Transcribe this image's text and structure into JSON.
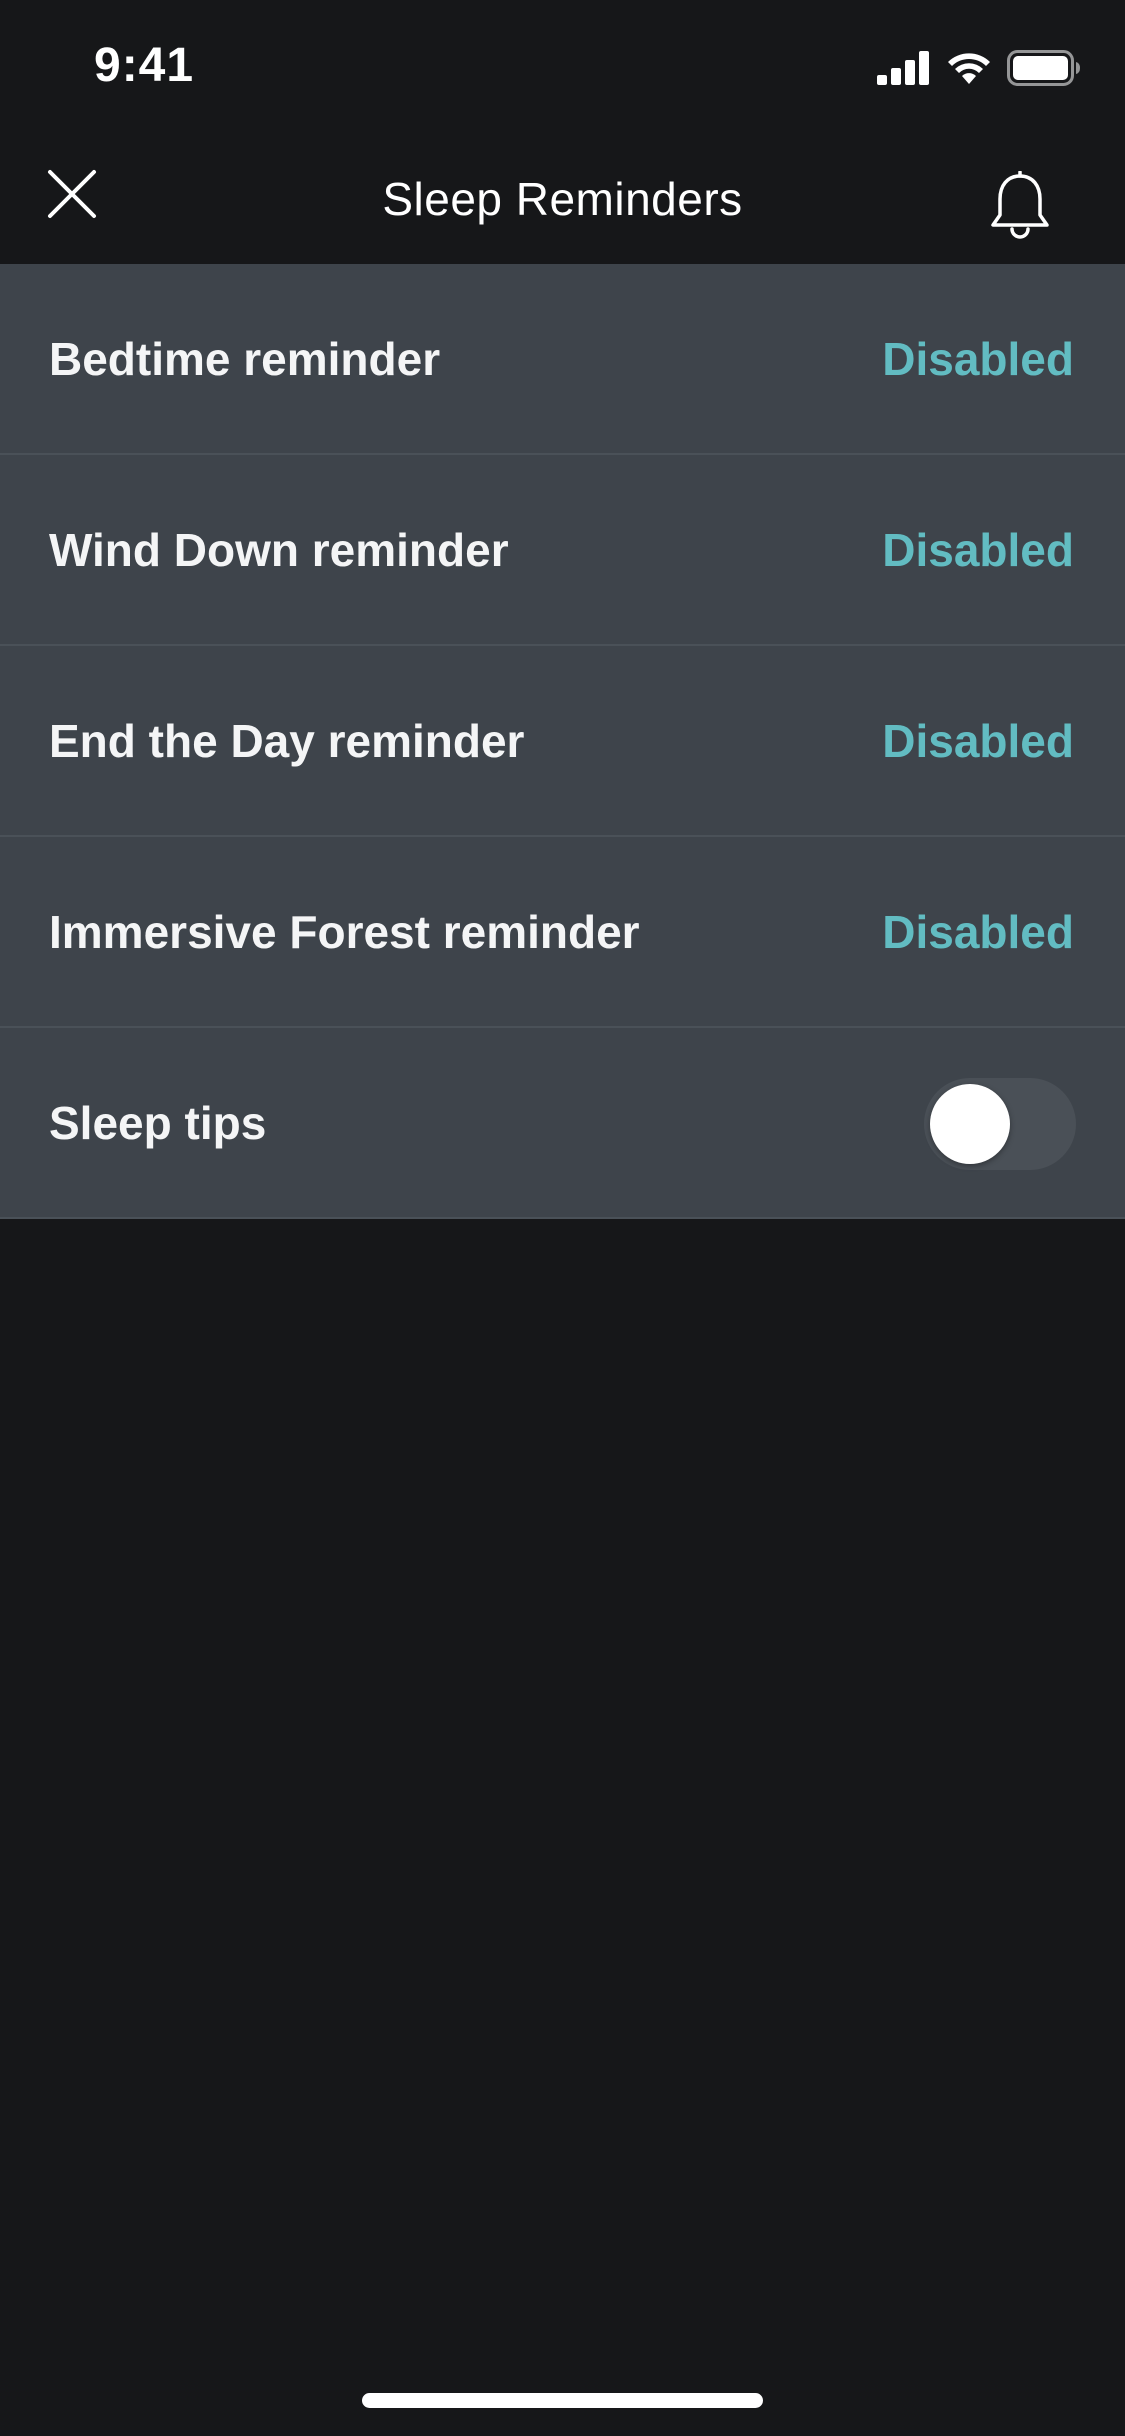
{
  "status_bar": {
    "time": "9:41",
    "icons": [
      "cellular-signal-icon",
      "wifi-icon",
      "battery-icon"
    ]
  },
  "nav": {
    "title": "Sleep Reminders",
    "close_icon": "close-icon",
    "bell_icon": "bell-icon"
  },
  "reminders": {
    "items": [
      {
        "label": "Bedtime reminder",
        "value": "Disabled"
      },
      {
        "label": "Wind Down reminder",
        "value": "Disabled"
      },
      {
        "label": "End the Day reminder",
        "value": "Disabled"
      },
      {
        "label": "Immersive Forest reminder",
        "value": "Disabled"
      }
    ],
    "sleep_tips": {
      "label": "Sleep tips",
      "enabled": false
    }
  },
  "colors": {
    "background": "#161719",
    "row_background": "#3e444b",
    "accent": "#62bcc2",
    "toggle_off": "#4a5057"
  }
}
